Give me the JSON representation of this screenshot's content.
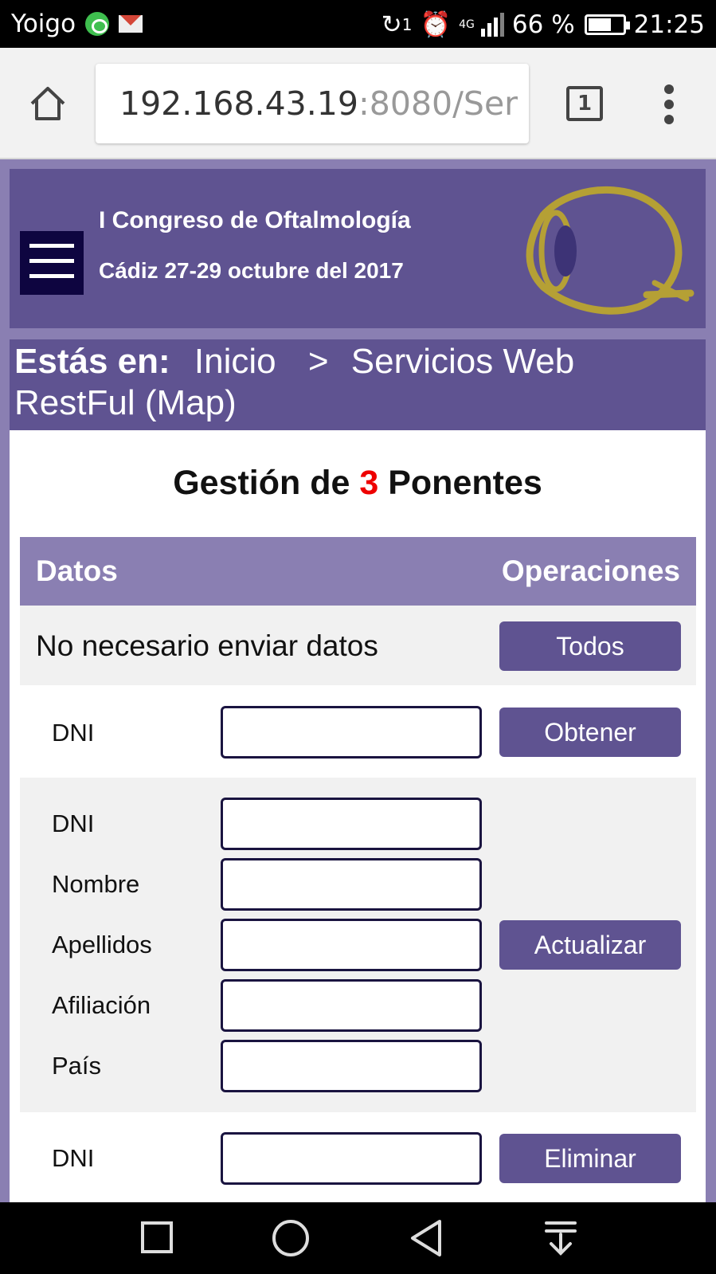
{
  "status_bar": {
    "carrier": "Yoigo",
    "network": "4G",
    "sync_count": "1",
    "battery": "66 %",
    "time": "21:25"
  },
  "browser": {
    "url_host": "192.168.43.19",
    "url_rest": ":8080/Ser",
    "tab_count": "1"
  },
  "header": {
    "title": "I Congreso de Oftalmología",
    "subtitle": "Cádiz 27-29 octubre del 2017",
    "accent_color": "#5f5391",
    "logo_color": "#b5a035"
  },
  "breadcrumb": {
    "label": "Estás en:",
    "home": "Inicio",
    "separator": ">",
    "current": "Servicios Web RestFul (Map)"
  },
  "main": {
    "title_prefix": "Gestión de",
    "title_count": "3",
    "title_suffix": "Ponentes"
  },
  "table": {
    "col_data": "Datos",
    "col_ops": "Operaciones",
    "row_all": {
      "text": "No necesario enviar datos",
      "button": "Todos"
    },
    "row_get": {
      "label_dni": "DNI",
      "dni_value": "",
      "button": "Obtener"
    },
    "row_update": {
      "label_dni": "DNI",
      "label_nombre": "Nombre",
      "label_apellidos": "Apellidos",
      "label_afiliacion": "Afiliación",
      "label_pais": "País",
      "dni_value": "",
      "nombre_value": "",
      "apellidos_value": "",
      "afiliacion_value": "",
      "pais_value": "",
      "button": "Actualizar"
    },
    "row_delete": {
      "label_dni": "DNI",
      "dni_value": "",
      "button": "Eliminar"
    }
  }
}
